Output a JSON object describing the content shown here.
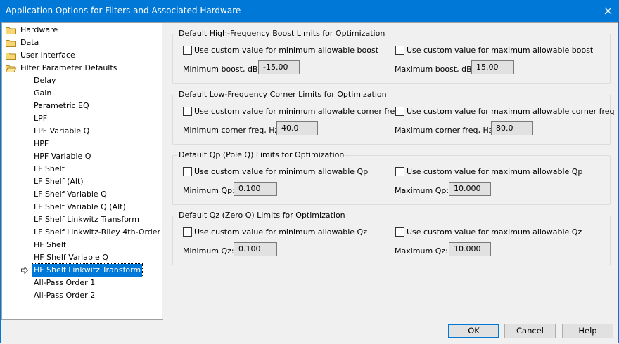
{
  "window": {
    "title": "Application Options for Filters and Associated Hardware",
    "accent_color": "#0078d7"
  },
  "tree": {
    "folders": [
      {
        "label": "Hardware",
        "icon": "folder-icon"
      },
      {
        "label": "Data",
        "icon": "folder-icon"
      },
      {
        "label": "User Interface",
        "icon": "folder-icon"
      },
      {
        "label": "Filter Parameter Defaults",
        "icon": "folder-open-icon"
      }
    ],
    "items": [
      "Delay",
      "Gain",
      "Parametric EQ",
      "LPF",
      "LPF Variable Q",
      "HPF",
      "HPF Variable Q",
      "LF Shelf",
      "LF Shelf (Alt)",
      "LF Shelf Variable Q",
      "LF Shelf Variable Q (Alt)",
      "LF Shelf Linkwitz Transform",
      "LF Shelf Linkwitz-Riley 4th-Order",
      "HF Shelf",
      "HF Shelf Variable Q",
      "HF Shelf Linkwitz Transform",
      "All-Pass Order 1",
      "All-Pass Order 2"
    ],
    "selected_item": "HF Shelf Linkwitz Transform"
  },
  "groups": [
    {
      "title": "Default High-Frequency Boost Limits for Optimization",
      "min_checkbox": "Use custom value for minimum allowable boost",
      "max_checkbox": "Use custom value for maximum allowable boost",
      "min_label": "Minimum boost, dB:",
      "min_value": "-15.00",
      "max_label": "Maximum boost, dB:",
      "max_value": "15.00"
    },
    {
      "title": "Default Low-Frequency Corner Limits for Optimization",
      "min_checkbox": "Use custom value for minimum allowable corner freq",
      "max_checkbox": "Use custom value for maximum allowable corner freq",
      "min_label": "Minimum corner freq, Hz:",
      "min_value": "40.0",
      "max_label": "Maximum corner freq, Hz:",
      "max_value": "80.0"
    },
    {
      "title": "Default Qp (Pole Q) Limits for Optimization",
      "min_checkbox": "Use custom value for minimum allowable Qp",
      "max_checkbox": "Use custom value for maximum allowable Qp",
      "min_label": "Minimum Qp:",
      "min_value": "0.100",
      "max_label": "Maximum Qp:",
      "max_value": "10.000"
    },
    {
      "title": "Default Qz (Zero Q) Limits for Optimization",
      "min_checkbox": "Use custom value for minimum allowable Qz",
      "max_checkbox": "Use custom value for maximum allowable Qz",
      "min_label": "Minimum Qz:",
      "min_value": "0.100",
      "max_label": "Maximum Qz:",
      "max_value": "10.000"
    }
  ],
  "buttons": {
    "ok": "OK",
    "cancel": "Cancel",
    "help": "Help"
  }
}
